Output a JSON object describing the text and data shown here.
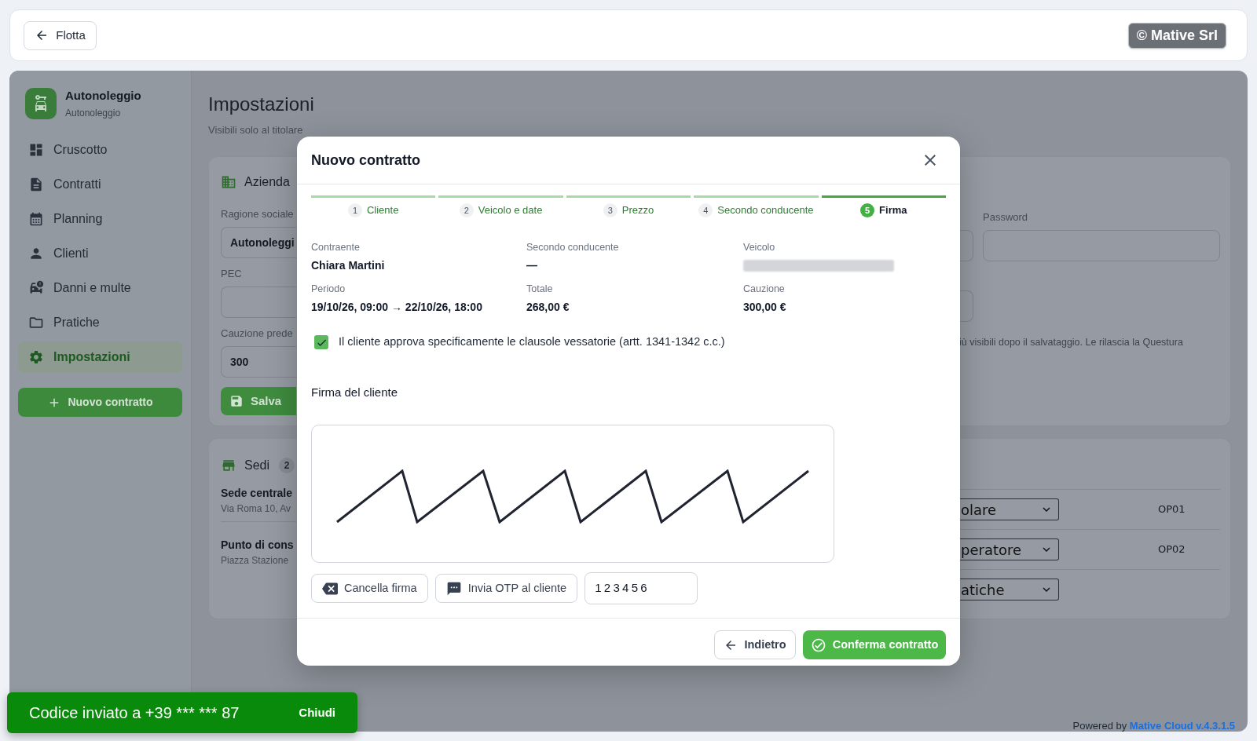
{
  "top_bar": {
    "back_button": "Flotta",
    "copyright_badge": "© Mative Srl"
  },
  "sidebar": {
    "brand": {
      "name": "Autonoleggio",
      "subtitle": "Autonoleggio"
    },
    "items": [
      {
        "label": "Cruscotto",
        "selected": false
      },
      {
        "label": "Contratti",
        "selected": false
      },
      {
        "label": "Planning",
        "selected": false
      },
      {
        "label": "Clienti",
        "selected": false
      },
      {
        "label": "Danni e multe",
        "selected": false
      },
      {
        "label": "Pratiche",
        "selected": false
      },
      {
        "label": "Impostazioni",
        "selected": true
      }
    ],
    "new_contract_button": "Nuovo contratto"
  },
  "page": {
    "title": "Impostazioni",
    "subtitle": "Visibili solo al titolare",
    "company_card": {
      "heading": "Azienda",
      "fields": [
        {
          "label": "Ragione sociale",
          "value": "Autonoleggi"
        },
        {
          "label": "PEC"
        },
        {
          "label": "Cauzione prede",
          "value": "300"
        }
      ],
      "save_button": "Salva",
      "password_label": "Password",
      "note": "iù visibili dopo il salvataggio. Le rilascia la Questura"
    },
    "locations_card": {
      "heading": "Sedi",
      "count": "2",
      "locations": [
        {
          "name": "Sede centrale",
          "address": "Via Roma 10, Av"
        },
        {
          "name": "Punto di cons",
          "address": "Piazza Stazione"
        }
      ],
      "operator_rows": [
        {
          "role": "olare",
          "code": "OP01"
        },
        {
          "role": "peratore",
          "code": "OP02"
        },
        {
          "role": "atiche"
        }
      ]
    }
  },
  "modal": {
    "title": "Nuovo contratto",
    "steps": [
      {
        "number": "1",
        "label": "Cliente",
        "selected": false
      },
      {
        "number": "2",
        "label": "Veicolo e date",
        "selected": false
      },
      {
        "number": "3",
        "label": "Prezzo",
        "selected": false
      },
      {
        "number": "4",
        "label": "Secondo conducente",
        "selected": false
      },
      {
        "number": "5",
        "label": "Firma",
        "selected": true
      }
    ],
    "summary": [
      {
        "kind": "text",
        "label": "Contraente",
        "value": "Chiara Martini"
      },
      {
        "kind": "text",
        "label": "Secondo conducente",
        "value": "—"
      },
      {
        "kind": "redacted",
        "label": "Veicolo"
      },
      {
        "kind": "text",
        "label": "Periodo",
        "value": "19/10/26, 09:00 → 22/10/26, 18:00"
      },
      {
        "kind": "text",
        "label": "Totale",
        "value": "268,00 €"
      },
      {
        "kind": "text",
        "label": "Cauzione",
        "value": "300,00 €"
      }
    ],
    "consent": {
      "label": "Il cliente approva specificamente le clausole vessatorie (artt. 1341-1342 c.c.)",
      "checked": true
    },
    "signature_label": "Firma del cliente",
    "clear_button": "Cancella firma",
    "otp_button": "Invia OTP al cliente",
    "otp_value": "123456",
    "back_button": "Indietro",
    "confirm_button": "Conferma contratto"
  },
  "toast": {
    "message": "Codice inviato a +39 *** *** 87",
    "action": "Chiudi"
  },
  "footer": {
    "prefix": "Powered by",
    "link": "Mative Cloud v.4.3.1.5"
  }
}
